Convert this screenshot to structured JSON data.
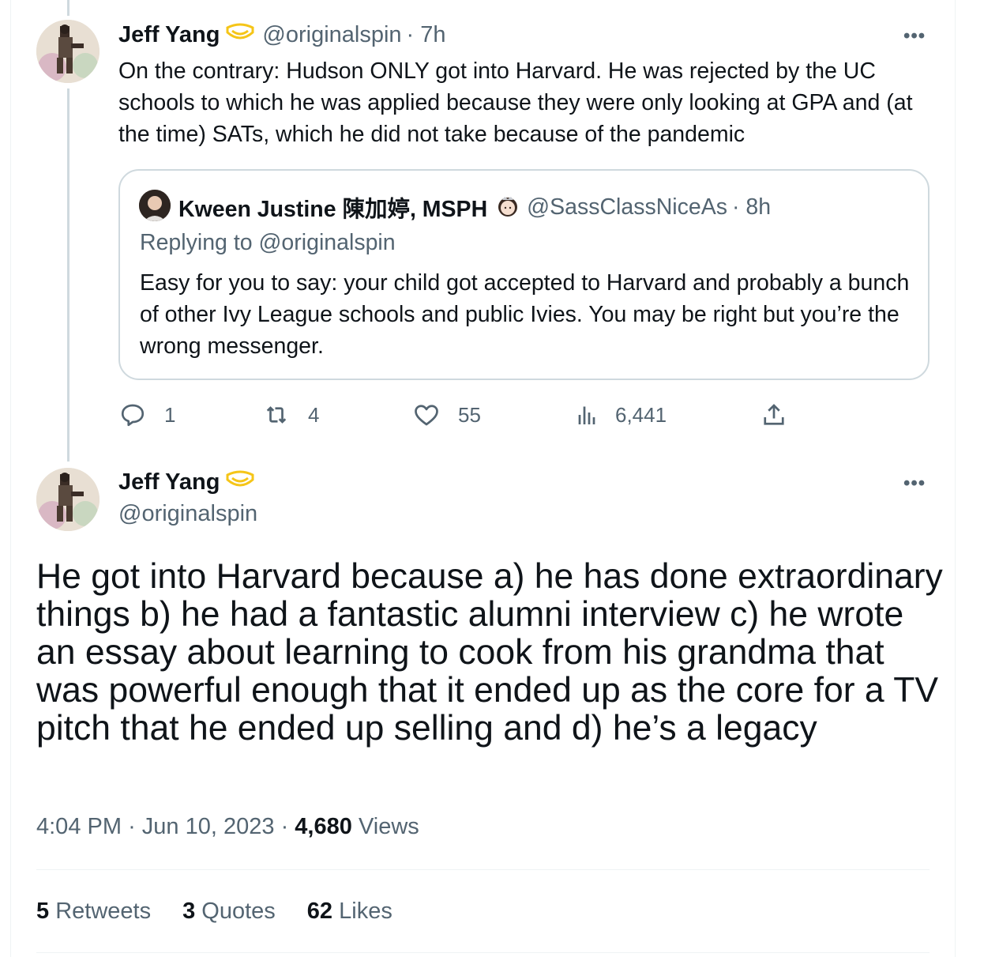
{
  "reply_tweet": {
    "author_name": "Jeff Yang",
    "handle": "@originalspin",
    "time": "· 7h",
    "more_label": "•••",
    "text": "On the contrary: Hudson ONLY got into Harvard. He was rejected by the UC schools to which he was applied because they were only looking at GPA and (at the time) SATs, which he did not take because of the pandemic",
    "quoted": {
      "author_name": "Kween Justine 陳加婷, MSPH",
      "handle": "@SassClassNiceAs",
      "time": "· 8h",
      "replying_to": "Replying to @originalspin",
      "text": "Easy for you to say: your child got accepted to Harvard and probably a bunch of other Ivy League schools and public Ivies. You may be right but you’re the wrong messenger."
    },
    "actions": {
      "replies": "1",
      "retweets": "4",
      "likes": "55",
      "views": "6,441"
    }
  },
  "main_tweet": {
    "author_name": "Jeff Yang",
    "handle": "@originalspin",
    "more_label": "•••",
    "text": "He got into Harvard because a) he has done extraordinary things b) he had a fantastic alumni interview c) he wrote an essay about learning to cook from his grandma that was powerful enough that it ended up as the core for a TV pitch that he ended up selling and d) he’s a legacy",
    "time": "4:04 PM",
    "date": "Jun 10, 2023",
    "separator": "·",
    "views_count": "4,680",
    "views_label": "Views",
    "stats": {
      "retweets_count": "5",
      "retweets_label": "Retweets",
      "quotes_count": "3",
      "quotes_label": "Quotes",
      "likes_count": "62",
      "likes_label": "Likes"
    }
  },
  "colors": {
    "text": "#0f1419",
    "secondary": "#536471",
    "border": "#cfd9de",
    "badge": "#f5c518"
  },
  "icons": [
    "reply-icon",
    "retweet-icon",
    "like-icon",
    "views-icon",
    "share-icon",
    "verified-badge-icon",
    "more-icon",
    "princess-emoji-icon"
  ]
}
